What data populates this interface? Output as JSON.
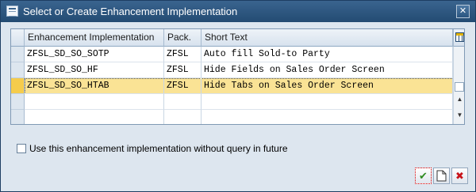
{
  "window": {
    "title": "Select or Create Enhancement Implementation",
    "close_glyph": "✕"
  },
  "table": {
    "columns": [
      "Enhancement Implementation",
      "Pack.",
      "Short Text"
    ],
    "rows": [
      {
        "impl": "ZFSL_SD_SO_SOTP",
        "pack": "ZFSL",
        "text": "Auto fill Sold-to Party",
        "selected": false
      },
      {
        "impl": "ZFSL_SD_SO_HF",
        "pack": "ZFSL",
        "text": "Hide Fields on Sales Order Screen",
        "selected": false
      },
      {
        "impl": "ZFSL_SD_SO_HTAB",
        "pack": "ZFSL",
        "text": "Hide Tabs on Sales Order Screen",
        "selected": true
      },
      {
        "impl": "",
        "pack": "",
        "text": "",
        "selected": false
      },
      {
        "impl": "",
        "pack": "",
        "text": "",
        "selected": false
      }
    ],
    "highlight_color": "#fae395",
    "selected_marker_color": "#f5cc4c"
  },
  "checkbox": {
    "label": "Use this enhancement implementation without query in future",
    "checked": false
  },
  "buttons": {
    "confirm_icon": "check-icon",
    "confirm_glyph": "✔",
    "create_icon": "new-document-icon",
    "cancel_icon": "cancel-icon",
    "cancel_glyph": "✖"
  }
}
